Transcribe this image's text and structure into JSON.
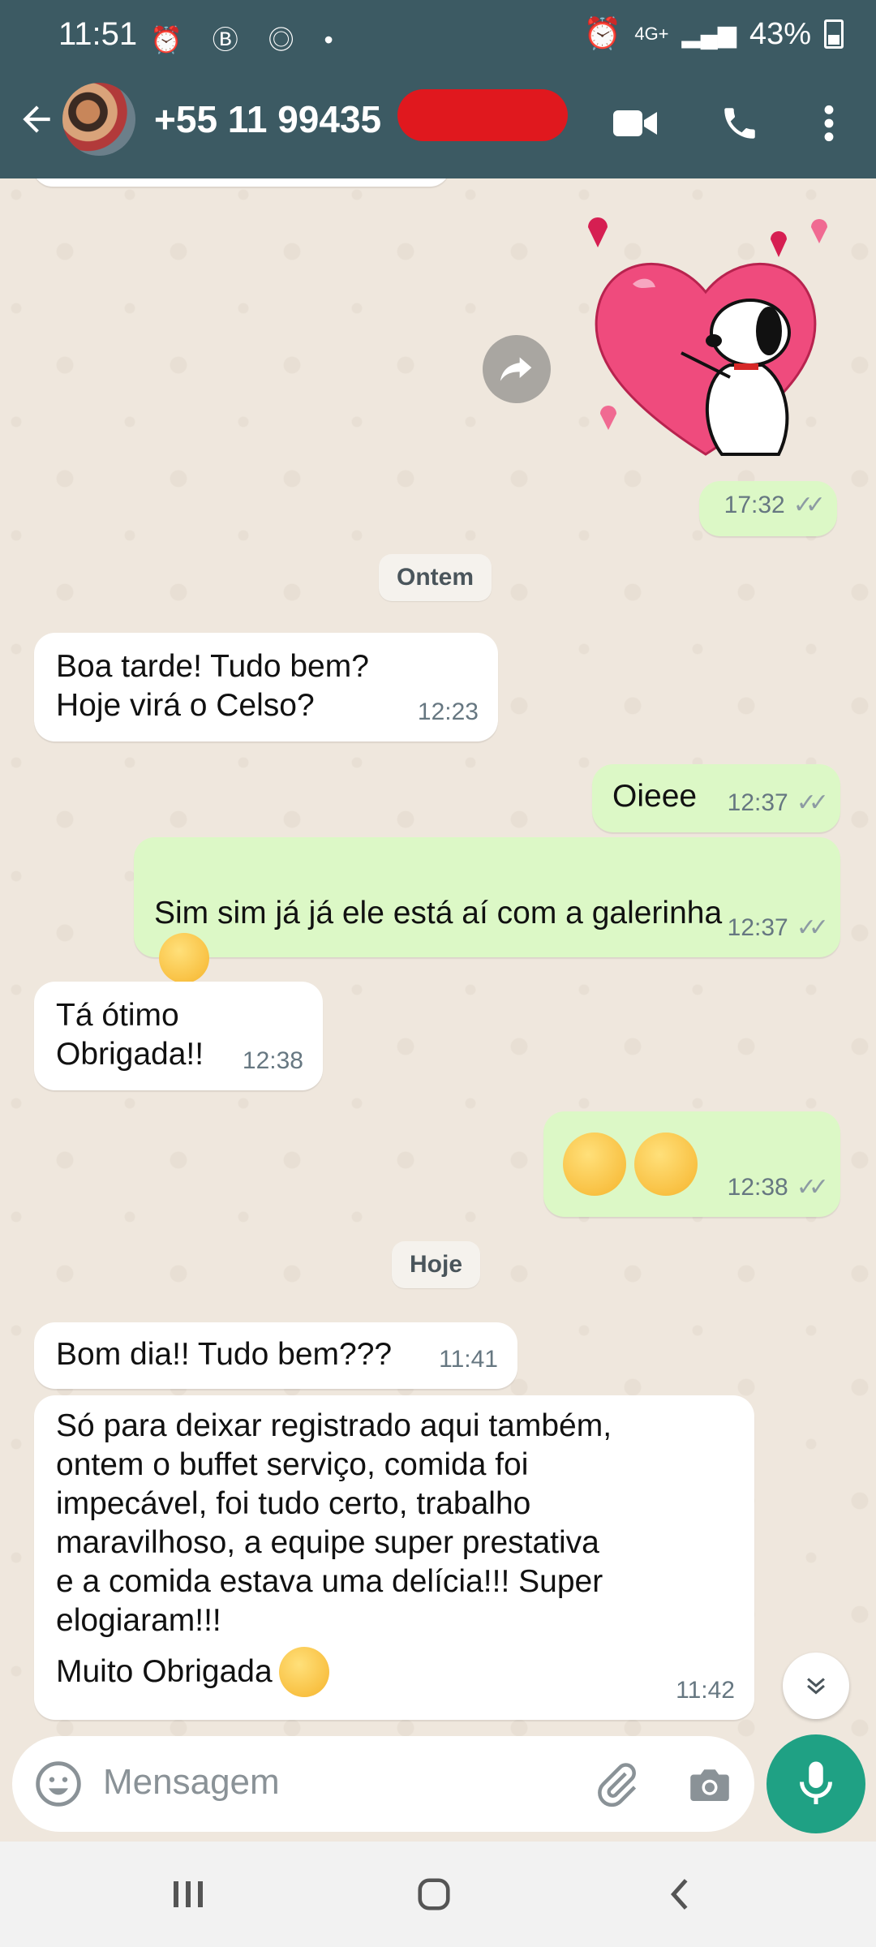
{
  "status_bar": {
    "time": "11:51",
    "icons": "⏰ Ⓑ ◎ •",
    "network": "4G+",
    "battery": "43%"
  },
  "header": {
    "contact": "+55 11 99435"
  },
  "messages": [
    {
      "text": "",
      "time": "17:32"
    },
    {
      "text": "Boa tarde! Tudo bem?\nHoje virá o Celso?",
      "time": "12:23"
    },
    {
      "text": "Oieee",
      "time": "12:37"
    },
    {
      "text": "Sim sim já já ele está aí com a galerinha",
      "time": "12:37"
    },
    {
      "text": "Tá ótimo\nObrigada!!",
      "time": "12:38"
    },
    {
      "text": "",
      "time": "12:38"
    },
    {
      "text": "Bom dia!! Tudo bem???",
      "time": "11:41"
    },
    {
      "text": "Só para deixar registrado aqui também,\nontem o buffet serviço, comida foi\nimpecável, foi tudo certo, trabalho\nmaravilhoso, a equipe super prestativa\ne a comida estava uma delícia!!! Super\nelogiaram!!!",
      "text2": "Muito Obrigada",
      "time": "11:42"
    }
  ],
  "date_separators": {
    "yesterday": "Ontem",
    "today": "Hoje"
  },
  "composer": {
    "placeholder": "Mensagem"
  },
  "colors": {
    "header": "#3c5a63",
    "chat_bg": "#efe7dd",
    "outgoing_bubble": "#dcf8c6",
    "incoming_bubble": "#ffffff",
    "mic_button": "#1fa184",
    "redaction": "#e0181e"
  },
  "icons": [
    "back-arrow-icon",
    "video-call-icon",
    "phone-icon",
    "more-vert-icon",
    "forward-icon",
    "double-check-icon",
    "emoji-icon",
    "attach-icon",
    "camera-icon",
    "mic-icon",
    "scroll-down-icon",
    "recents-icon",
    "home-icon",
    "nav-back-icon"
  ]
}
